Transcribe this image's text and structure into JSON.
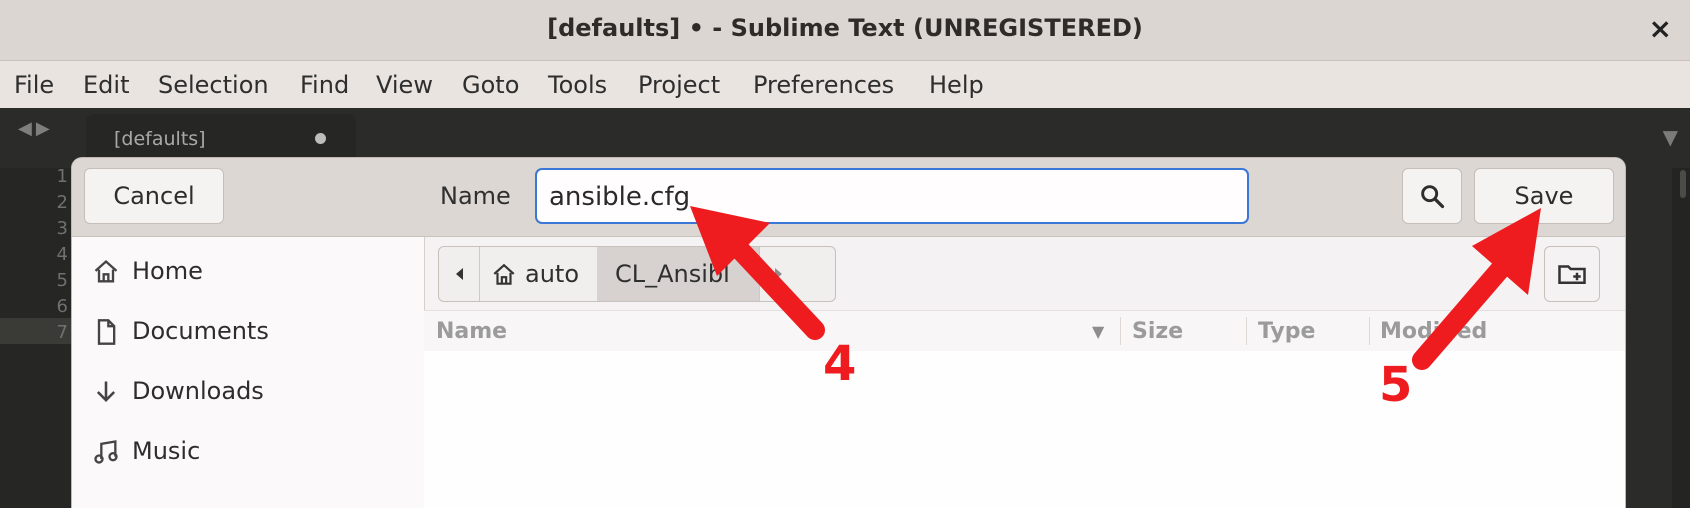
{
  "window": {
    "title": "[defaults] • - Sublime Text (UNREGISTERED)",
    "close_glyph": "×"
  },
  "menu": [
    "File",
    "Edit",
    "Selection",
    "Find",
    "View",
    "Goto",
    "Tools",
    "Project",
    "Preferences",
    "Help"
  ],
  "editor": {
    "tab_label": "[defaults]",
    "line_numbers": [
      "1",
      "2",
      "3",
      "4",
      "5",
      "6",
      "7"
    ]
  },
  "dialog": {
    "cancel_label": "Cancel",
    "name_label": "Name",
    "name_value": "ansible.cfg",
    "save_label": "Save",
    "sidebar": [
      {
        "label": "Home",
        "icon": "home-icon"
      },
      {
        "label": "Documents",
        "icon": "document-icon"
      },
      {
        "label": "Downloads",
        "icon": "download-icon"
      },
      {
        "label": "Music",
        "icon": "music-icon"
      }
    ],
    "breadcrumbs": [
      "auto",
      "CL_Ansibl"
    ],
    "columns": [
      "Name",
      "Size",
      "Type",
      "Modified"
    ]
  },
  "annotations": {
    "step4": "4",
    "step5": "5",
    "color": "#ee1b1f"
  }
}
